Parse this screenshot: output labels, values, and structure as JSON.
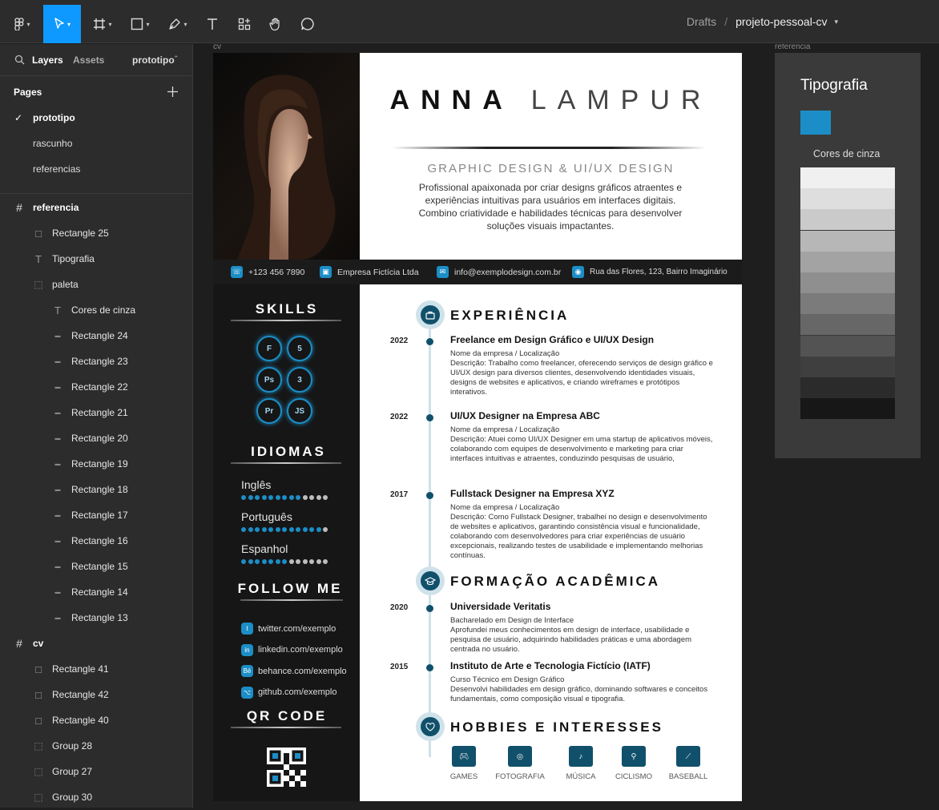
{
  "topbar": {
    "breadcrumb_drafts": "Drafts",
    "breadcrumb_sep": "/",
    "file_name": "projeto-pessoal-cv",
    "icons": [
      "figma-menu-icon",
      "move-tool-icon",
      "frame-tool-icon",
      "shape-tool-icon",
      "pen-tool-icon",
      "text-tool-icon",
      "resources-icon",
      "hand-tool-icon",
      "comment-icon"
    ]
  },
  "sidebar": {
    "tab_layers": "Layers",
    "tab_assets": "Assets",
    "current_page": "prototipo",
    "pages_title": "Pages",
    "pages": [
      {
        "label": "prototipo",
        "selected": true
      },
      {
        "label": "rascunho",
        "selected": false
      },
      {
        "label": "referencias",
        "selected": false
      }
    ],
    "layers": [
      {
        "label": "referencia",
        "type": "frame",
        "indent": 0
      },
      {
        "label": "Rectangle 25",
        "type": "rect",
        "indent": 1
      },
      {
        "label": "Tipografia",
        "type": "text",
        "indent": 1
      },
      {
        "label": "paleta",
        "type": "group",
        "indent": 1
      },
      {
        "label": "Cores de cinza",
        "type": "text",
        "indent": 2
      },
      {
        "label": "Rectangle 24",
        "type": "line",
        "indent": 2
      },
      {
        "label": "Rectangle 23",
        "type": "line",
        "indent": 2
      },
      {
        "label": "Rectangle 22",
        "type": "line",
        "indent": 2
      },
      {
        "label": "Rectangle 21",
        "type": "line",
        "indent": 2
      },
      {
        "label": "Rectangle 20",
        "type": "line",
        "indent": 2
      },
      {
        "label": "Rectangle 19",
        "type": "line",
        "indent": 2
      },
      {
        "label": "Rectangle 18",
        "type": "line",
        "indent": 2
      },
      {
        "label": "Rectangle 17",
        "type": "line",
        "indent": 2
      },
      {
        "label": "Rectangle 16",
        "type": "line",
        "indent": 2
      },
      {
        "label": "Rectangle 15",
        "type": "line",
        "indent": 2
      },
      {
        "label": "Rectangle 14",
        "type": "line",
        "indent": 2
      },
      {
        "label": "Rectangle 13",
        "type": "line",
        "indent": 2
      },
      {
        "label": "cv",
        "type": "frame",
        "indent": 0
      },
      {
        "label": "Rectangle 41",
        "type": "rect",
        "indent": 1
      },
      {
        "label": "Rectangle 42",
        "type": "rect",
        "indent": 1
      },
      {
        "label": "Rectangle 40",
        "type": "rect",
        "indent": 1
      },
      {
        "label": "Group 28",
        "type": "group",
        "indent": 1
      },
      {
        "label": "Group 27",
        "type": "group",
        "indent": 1
      },
      {
        "label": "Group 30",
        "type": "group",
        "indent": 1
      }
    ]
  },
  "canvas": {
    "cv_label": "cv",
    "ref_label": "referencia"
  },
  "cv": {
    "first_name": "ANNA",
    "last_name": "LAMPUR",
    "role": "GRAPHIC DESIGN & UI/UX DESIGN",
    "about": "Profissional apaixonada por criar designs gráficos atraentes e experiências intuitivas para usuários em interfaces digitais. Combino criatividade e habilidades técnicas para desenvolver soluções visuais impactantes.",
    "contacts": [
      {
        "icon": "phone-icon",
        "text": "+123 456 7890"
      },
      {
        "icon": "company-icon",
        "text": "Empresa Fictícia Ltda"
      },
      {
        "icon": "mail-icon",
        "text": "info@exemplodesign.com.br"
      },
      {
        "icon": "location-icon",
        "text": "Rua das Flores, 123, Bairro Imaginário"
      }
    ],
    "skills_title": "SKILLS",
    "skills": [
      {
        "name": "figma-icon",
        "glyph": "F"
      },
      {
        "name": "html5-icon",
        "glyph": "5"
      },
      {
        "name": "photoshop-icon",
        "glyph": "Ps"
      },
      {
        "name": "css3-icon",
        "glyph": "3"
      },
      {
        "name": "premiere-icon",
        "glyph": "Pr"
      },
      {
        "name": "javascript-icon",
        "glyph": "JS"
      }
    ],
    "languages_title": "IDIOMAS",
    "languages": [
      {
        "name": "Inglês",
        "level": 9,
        "max": 13
      },
      {
        "name": "Português",
        "level": 12,
        "max": 13
      },
      {
        "name": "Espanhol",
        "level": 7,
        "max": 13
      }
    ],
    "follow_title": "FOLLOW ME",
    "follow": [
      {
        "icon": "twitter-icon",
        "text": "twitter.com/exemplo"
      },
      {
        "icon": "linkedin-icon",
        "text": "linkedin.com/exemplo"
      },
      {
        "icon": "behance-icon",
        "text": "behance.com/exemplo"
      },
      {
        "icon": "github-icon",
        "text": "github.com/exemplo"
      }
    ],
    "qr_title": "QR CODE",
    "experience_title": "EXPERIÊNCIA",
    "experience": [
      {
        "year": "2022",
        "title": "Freelance em Design Gráfico e UI/UX Design",
        "company": "Nome da empresa / Localização",
        "desc": "Descrição: Trabalho como freelancer, oferecendo serviços de design gráfico e UI/UX design para diversos clientes, desenvolvendo identidades visuais, designs de websites e aplicativos, e criando wireframes e protótipos interativos."
      },
      {
        "year": "2022",
        "title": "UI/UX Designer na Empresa ABC",
        "company": "Nome da empresa / Localização",
        "desc": "Descrição: Atuei como UI/UX Designer em uma startup de aplicativos móveis, colaborando com equipes de desenvolvimento e marketing para criar interfaces intuitivas e atraentes, conduzindo pesquisas de usuário,"
      },
      {
        "year": "2017",
        "title": "Fullstack Designer na Empresa XYZ",
        "company": "Nome da empresa / Localização",
        "desc": "Descrição: Como Fullstack Designer, trabalhei no design e desenvolvimento de websites e aplicativos, garantindo consistência visual e funcionalidade, colaborando com desenvolvedores para criar experiências de usuário excepcionais, realizando testes de usabilidade e implementando melhorias contínuas."
      }
    ],
    "education_title": "FORMAÇÃO ACADÊMICA",
    "education": [
      {
        "year": "2020",
        "title": "Universidade Veritatis",
        "company": "Bacharelado em Design de Interface",
        "desc": "Aprofundei meus conhecimentos em design de interface, usabilidade e pesquisa de usuário, adquirindo habilidades práticas e uma abordagem centrada no usuário."
      },
      {
        "year": "2015",
        "title": "Instituto de Arte e Tecnologia Fictício (IATF)",
        "company": "Curso Técnico em Design Gráfico",
        "desc": "Desenvolvi habilidades em design gráfico, dominando softwares e conceitos fundamentais, como composição visual e tipografia."
      }
    ],
    "hobbies_title": "HOBBIES E INTERESSES",
    "hobbies": [
      {
        "icon": "gamepad-icon",
        "label": "GAMES"
      },
      {
        "icon": "camera-icon",
        "label": "FOTOGRAFIA"
      },
      {
        "icon": "guitar-icon",
        "label": "MÚSICA"
      },
      {
        "icon": "bicycle-icon",
        "label": "CICLISMO"
      },
      {
        "icon": "baseball-bat-icon",
        "label": "BASEBALL"
      }
    ]
  },
  "reference": {
    "title": "Tipografia",
    "accent": "#1c8ec7",
    "gray_title": "Cores de cinza",
    "grays": [
      "#f0f0f0",
      "#dedede",
      "#cacaca",
      "#b7b7b7",
      "#a3a3a3",
      "#8f8f8f",
      "#7b7b7b",
      "#676767",
      "#535353",
      "#3f3f3f",
      "#2b2b2b",
      "#171717"
    ]
  }
}
